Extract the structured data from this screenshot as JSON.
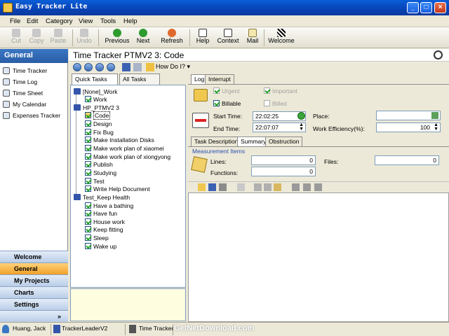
{
  "window": {
    "title": "Easy Tracker Lite",
    "min": "_",
    "max": "□",
    "close": "×"
  },
  "menu": [
    "File",
    "Edit",
    "Category",
    "View",
    "Tools",
    "Help"
  ],
  "toolbar": {
    "cut": "Cut",
    "copy": "Copy",
    "paste": "Paste",
    "undo": "Undo",
    "previous": "Previous",
    "next": "Next",
    "refresh": "Refresh",
    "help": "Help",
    "context": "Context",
    "mail": "Mail",
    "welcome": "Welcome"
  },
  "left": {
    "header": "General",
    "items": [
      "Time Tracker",
      "Time Log",
      "Time Sheet",
      "My Calendar",
      "Expenses Tracker"
    ],
    "nav": [
      "Welcome",
      "General",
      "My Projects",
      "Charts",
      "Settings"
    ],
    "more": "»"
  },
  "main": {
    "title": "Time Tracker  PTMV2 3: Code",
    "howdoi": "How Do I?",
    "tabs": [
      "Quick Tasks",
      "All Tasks"
    ]
  },
  "tree": {
    "groups": [
      {
        "name": "[None]_Work",
        "items": [
          "Work"
        ]
      },
      {
        "name": "HP_PTMV2 3",
        "items": [
          "Code",
          "Design",
          "Fix Bug",
          "Make Installation Disks",
          "Make work plan of xiaomei",
          "Make work plan of xiongyong",
          "Publish",
          "Studying",
          "Test",
          "Write Help Document"
        ]
      },
      {
        "name": "Test_Keep Health",
        "items": [
          "Have a bathing",
          "Have fun",
          "House work",
          "Keep fitting",
          "Sleep",
          "Wake up"
        ]
      }
    ]
  },
  "form": {
    "tabs": [
      "Log",
      "Interrupt"
    ],
    "urgent": "Urgent",
    "important": "Important",
    "billable": "Billable",
    "billed": "Billed",
    "start_label": "Start Time:",
    "start_value": "22:02:25",
    "end_label": "End Time:",
    "end_value": "22:07:07",
    "place_label": "Place:",
    "place_value": "",
    "efficiency_label": "Work Efficiency(%):",
    "efficiency_value": "100",
    "subtabs": [
      "Task Description",
      "Summary",
      "Obstruction"
    ],
    "measure_title": "Measurement Items",
    "lines_label": "Lines:",
    "lines_value": "0",
    "files_label": "Files:",
    "files_value": "0",
    "functions_label": "Functions:",
    "functions_value": "0"
  },
  "status": {
    "user": "Huang, Jack",
    "app": "TrackerLeaderV2",
    "view": "Time Tracker",
    "watermark": "GetNetDownload.com"
  }
}
